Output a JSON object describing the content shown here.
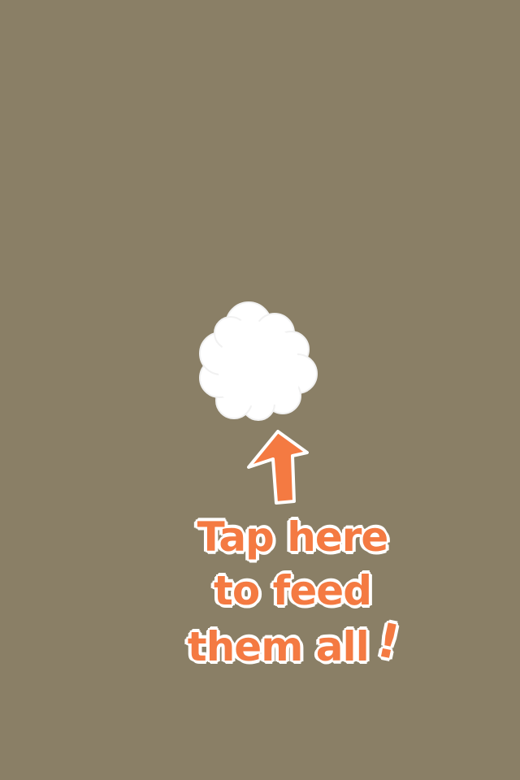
{
  "tutorial": {
    "line1": "Tap here",
    "line2": "to feed",
    "line3": "them all",
    "exclaim": "!"
  },
  "colors": {
    "background": "#8a7f66",
    "accent": "#f47a42",
    "food": "#ffffff"
  },
  "icons": {
    "food": "food-pile-icon",
    "arrow": "arrow-up-icon"
  }
}
